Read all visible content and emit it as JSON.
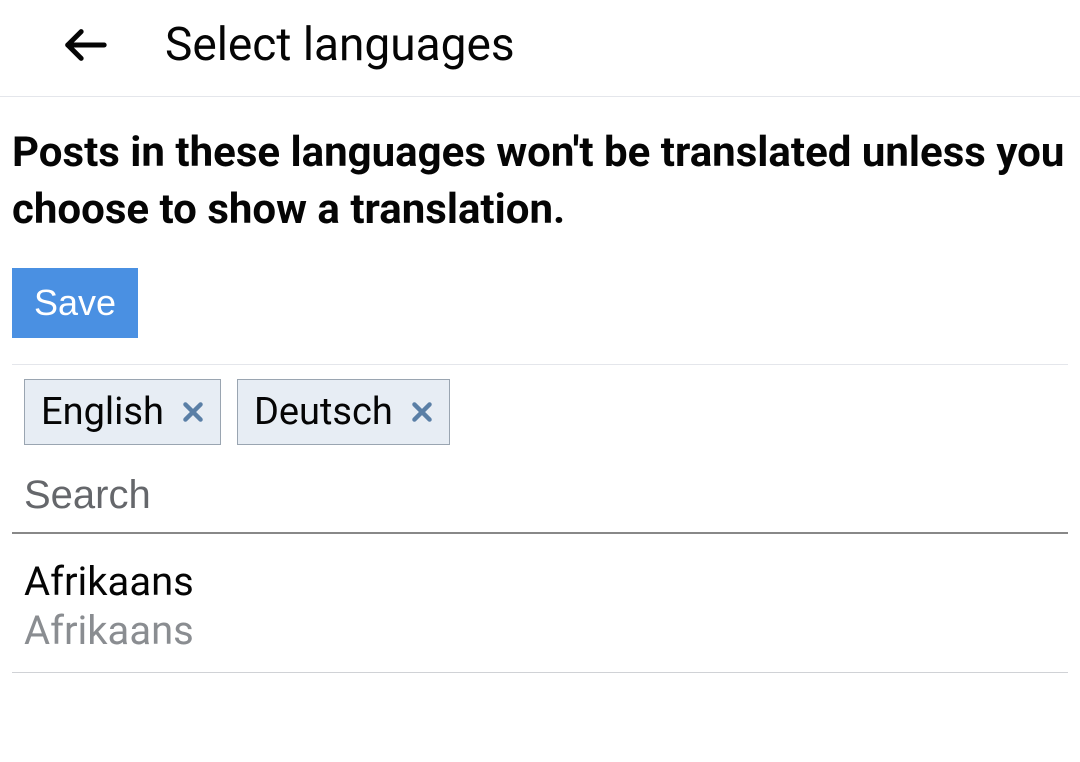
{
  "header": {
    "title": "Select languages"
  },
  "description": "Posts in these languages won't be translated unless you choose to show a translation.",
  "save_label": "Save",
  "chips": [
    {
      "label": "English"
    },
    {
      "label": "Deutsch"
    }
  ],
  "search": {
    "placeholder": "Search",
    "value": ""
  },
  "list": [
    {
      "title": "Afrikaans",
      "subtitle": "Afrikaans"
    }
  ]
}
